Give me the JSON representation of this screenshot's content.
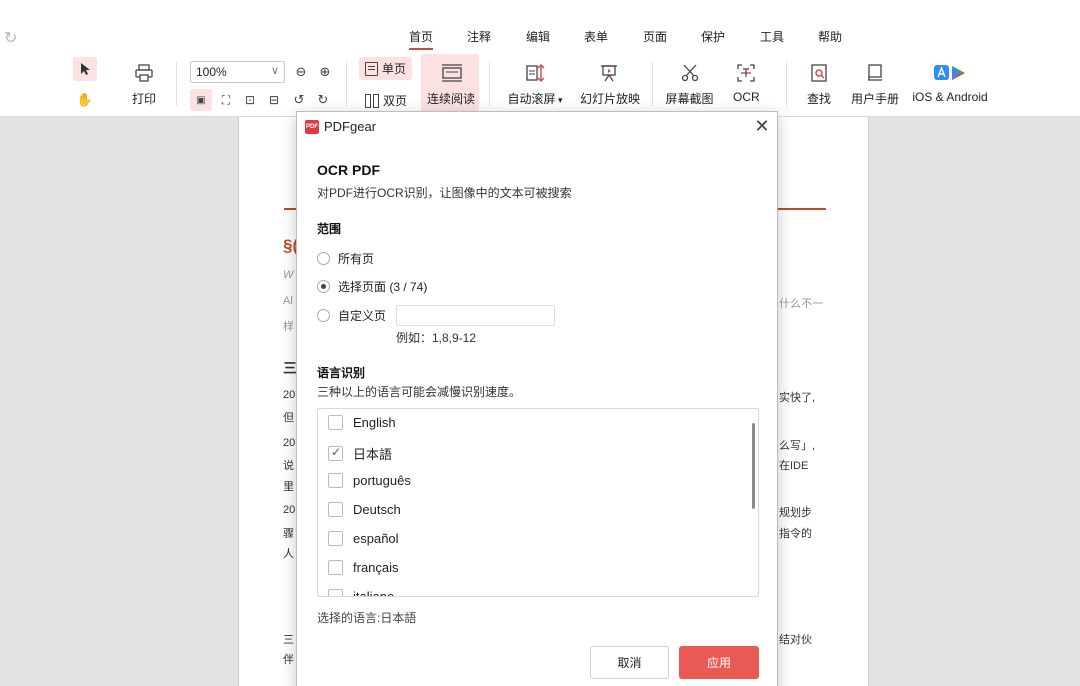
{
  "menu": {
    "tabs": [
      {
        "label": "首页",
        "active": true
      },
      {
        "label": "注释"
      },
      {
        "label": "编辑"
      },
      {
        "label": "表单"
      },
      {
        "label": "页面"
      },
      {
        "label": "保护"
      },
      {
        "label": "工具"
      },
      {
        "label": "帮助"
      }
    ]
  },
  "toolbar": {
    "print_label": "打印",
    "zoom_value": "100%",
    "single_page_label": "单页",
    "double_page_label": "双页",
    "continuous_label": "连续阅读",
    "auto_scroll_label": "自动滚屏",
    "slideshow_label": "幻灯片放映",
    "screenshot_label": "屏幕截图",
    "ocr_label": "OCR",
    "find_label": "查找",
    "manual_label": "用户手册",
    "mobile_label": "iOS & Android"
  },
  "document": {
    "section_mark": "§(",
    "line_w": "W",
    "line_al": "Al",
    "line_yang": "样",
    "right_1": "什么不一",
    "heading": "三",
    "para": [
      {
        "left": "20",
        "right": "实快了,"
      },
      {
        "left": "但",
        "right": ""
      },
      {
        "left": "20",
        "right": "么写」,"
      },
      {
        "left": "说",
        "right": "在IDE"
      },
      {
        "left": "里",
        "right": ""
      },
      {
        "left": "20",
        "right": "规划步"
      },
      {
        "left": "骤",
        "right": "指令的"
      },
      {
        "left": "人",
        "right": ""
      },
      {
        "left": "三",
        "right": "结对伙"
      },
      {
        "left": "伴",
        "right": ""
      }
    ]
  },
  "dialog": {
    "app_name": "PDFgear",
    "logo_text": "PDF",
    "close_symbol": "✕",
    "title": "OCR PDF",
    "subtitle": "对PDF进行OCR识别，让图像中的文本可被搜索",
    "range_title": "范围",
    "range_options": [
      {
        "label": "所有页",
        "selected": false
      },
      {
        "label": "选择页面 (3 / 74)",
        "selected": true
      },
      {
        "label": "自定义页",
        "selected": false
      }
    ],
    "custom_placeholder": "",
    "example": "例如：1,8,9-12",
    "lang_title": "语言识别",
    "lang_hint": "三种以上的语言可能会减慢识别速度。",
    "languages": [
      {
        "label": "English",
        "checked": false
      },
      {
        "label": "日本語",
        "checked": true
      },
      {
        "label": "português",
        "checked": false
      },
      {
        "label": "Deutsch",
        "checked": false
      },
      {
        "label": "español",
        "checked": false
      },
      {
        "label": "français",
        "checked": false
      },
      {
        "label": "italiano",
        "checked": false
      }
    ],
    "selected_text": "选择的语言:日本語",
    "cancel_label": "取消",
    "apply_label": "应用",
    "apply_color": "#e95a55"
  }
}
